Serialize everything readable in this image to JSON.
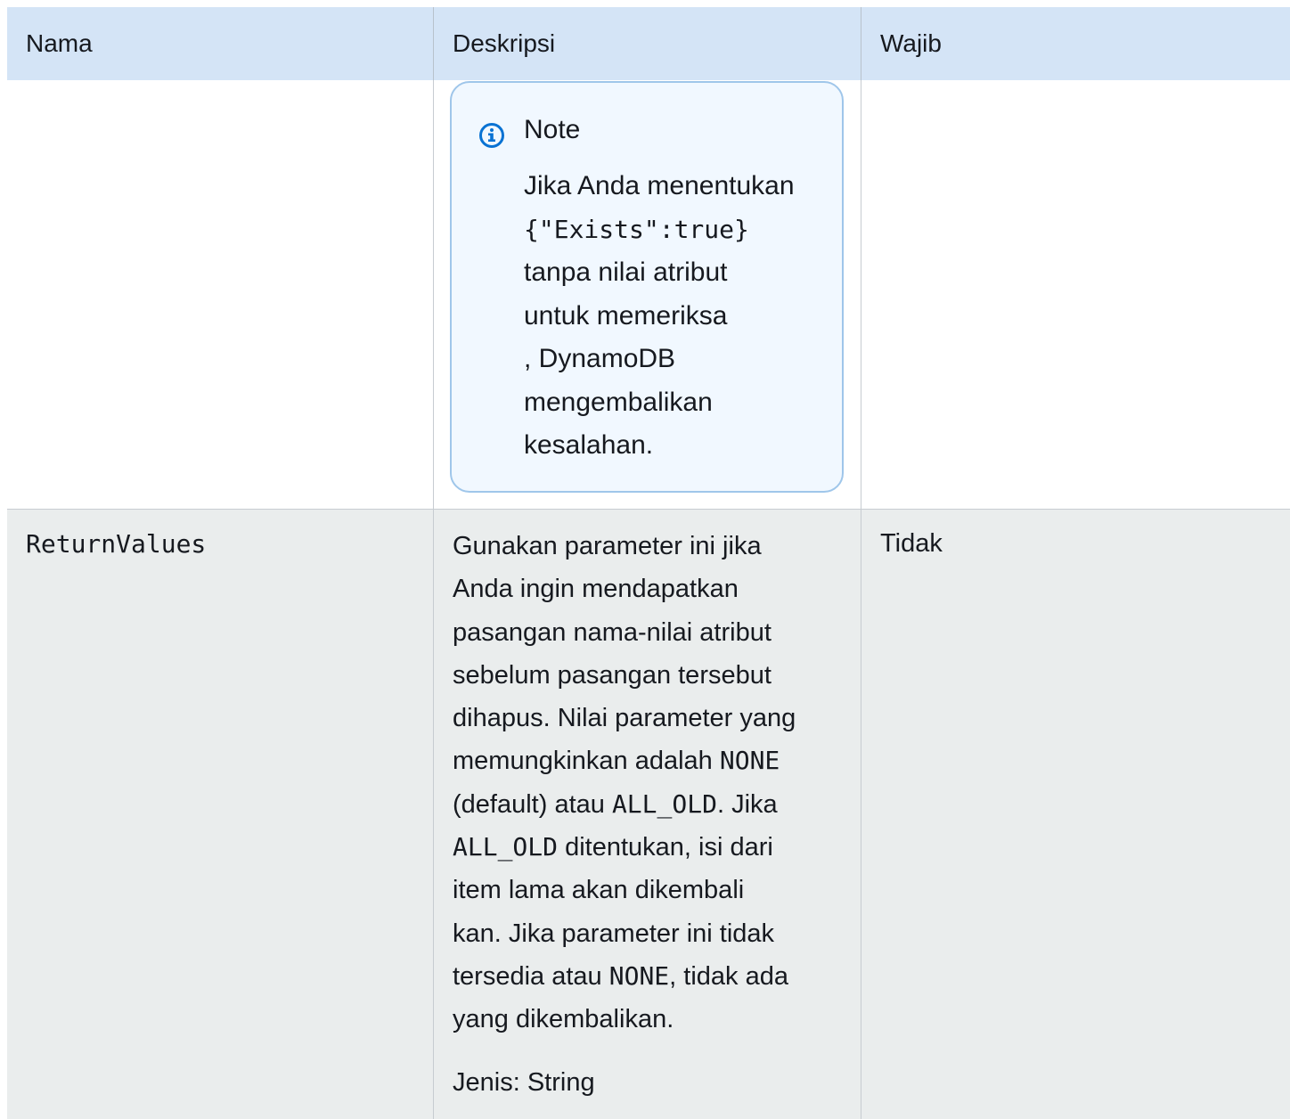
{
  "table": {
    "headers": {
      "name": "Nama",
      "description": "Deskripsi",
      "required": "Wajib"
    },
    "note": {
      "icon": "info-icon",
      "title": "Note",
      "line1": "Jika Anda menentukan",
      "code": "{\"Exists\":true}",
      "line2": "tanpa nilai atribut",
      "line3": "untuk memeriksa",
      "line4": ", DynamoDB",
      "line5": "mengembalikan",
      "line6": "kesalahan."
    },
    "row": {
      "name": "ReturnValues",
      "desc": {
        "l1": "Gunakan parameter ini jika",
        "l2": "Anda ingin mendapatkan",
        "l3": "pasangan nama-nilai atribut",
        "l4": "sebelum pasangan tersebut",
        "l5": "dihapus. Nilai parameter yang",
        "l6a": "memungkinkan adalah ",
        "l6code": "NONE",
        "l7a": "(default) atau ",
        "l7code": "ALL_OLD",
        "l7b": ". Jika",
        "l8code": "ALL_OLD",
        "l8b": " ditentukan, isi dari",
        "l9": "item lama akan dikembali",
        "l10": "kan. Jika parameter ini tidak",
        "l11a": "tersedia atau ",
        "l11code": "NONE",
        "l11b": ", tidak ada",
        "l12": "yang dikembalikan."
      },
      "type": "Jenis: String",
      "required": "Tidak"
    }
  },
  "colors": {
    "header_bg": "#d4e4f6",
    "note_bg": "#f1f8ff",
    "note_border": "#9fc6ea",
    "info_icon": "#0972d3",
    "row_alt_bg": "#eaeded"
  }
}
